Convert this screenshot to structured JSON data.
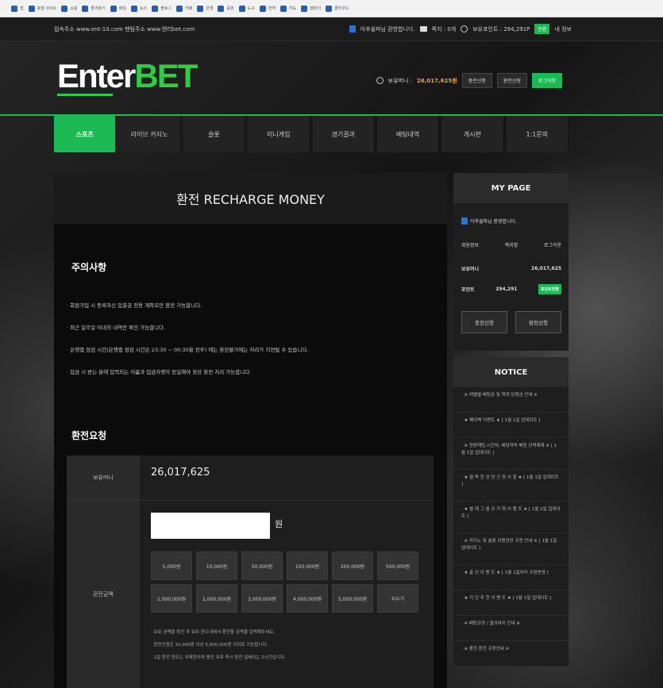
{
  "bookmarks": [
    "앱",
    "포털 사이트",
    "쇼핑",
    "즐겨찾기",
    "메일",
    "뉴스",
    "블로그",
    "카페",
    "은행",
    "증권",
    "도구",
    "번역",
    "지도",
    "캘린더",
    "클라우드"
  ],
  "topbar": {
    "site_address": "접속주소 www.ent-10.com 팬텀주소 www.엔터bet.com",
    "welcome": "아후쉴파님 환영합니다.",
    "messages": "쪽지 : 0개",
    "points_label": "보유포인트 : 294,291P",
    "points_btn": "전환",
    "my_info": "내 정보"
  },
  "header": {
    "logo_white": "Enter",
    "logo_green": "BET",
    "money_label": "보유머니 : ",
    "money_value": "26,017,625원",
    "btn_charge": "충전신청",
    "btn_exchange": "환전신청",
    "btn_logout": "로그아웃"
  },
  "nav": [
    "스포츠",
    "라이브 카지노",
    "슬롯",
    "미니게임",
    "경기결과",
    "배팅내역",
    "게시판",
    "1:1문의"
  ],
  "main": {
    "title": "환전 RECHARGE MONEY",
    "notice_title": "주의사항",
    "notices": [
      "회원가입 시 등록하신 입출금 전용 계좌로만 환전 가능합니다.",
      "최근 일주일 이내의 내역만 확인 가능합니다.",
      "은행별 점검 시간(은행별 점검 시간은 23:30 ~ 00:30을 전후) 에는 환전불가에는 처리가 지연될 수 있습니다.",
      "입금 시 받는 분에 입력되는 이름과 입금자명이 동일해야 정상 환전 처리 가능합니다."
    ],
    "request_title": "환전요청",
    "balance_label": "보유머니",
    "balance_value": "26,017,625",
    "amount_label": "환전금액",
    "amount_unit": "원",
    "amount_value": "",
    "quick_amounts": [
      "5,000원",
      "10,000원",
      "50,000원",
      "100,000원",
      "200,000원",
      "500,000원",
      "1,000,000원",
      "2,000,000원",
      "3,000,000원",
      "4,000,000원",
      "5,000,000원",
      "지우기"
    ],
    "hints": [
      "보유 금액을 확인 후 보유 한도내에서 환전할 금액을 입력해주세요.",
      "환전신청은 10,000원 이상 5,000,000원 이하로 가능합니다.",
      "1일 환전 한도는 무제한이며 충전 이후 즉시 환전 일배이는 2시간입니다."
    ]
  },
  "side": {
    "mypage_title": "MY PAGE",
    "welcome": "아후쉴파님 환영합니다.",
    "member_info": "회원정보",
    "messages": "쪽지함",
    "logout": "로그아웃",
    "money_label": "보유머니",
    "money_value": "26,017,625",
    "points_label": "포인트",
    "points_value": "294,291",
    "points_btn": "포인트전환",
    "btn_charge": "충전신청",
    "btn_exchange": "환전신청",
    "notice_title": "NOTICE",
    "notices": [
      "※ 레벨별 배팅금 및 최대 당첨금 안내 ※",
      "★ 페이백 이벤트 ★ [ 1월 1일 업데이트 ]",
      "※ 정방매팅,시간차, 배당하락 배팅 강력제재 ※ [ 1월 1일 업데이트 ]",
      "★ 월 독 한 앙 당 근 정 사 항 ★ [ 1월 1일 업데이트 ]",
      "★ 별 제 그 월 공 지 명 이 행 트 ★ [ 1월 2일 업데이트 ]",
      "※ 카지노 및 슬롯 이용관련 규정 안내 ※ [ 1월 1일 업데이트 ]",
      "★ 출 신 이 벤 트 ★ [ 1월 1일부터 규정변경 ]",
      "★ 지 인 추 천 이 벤 트 ★ [ 1월 1일 업데이트 ]",
      "※ 배팅규정 / 결과처리 안내 ※",
      "※ 충전 환전 규정안내 ※"
    ]
  },
  "colors": {
    "accent": "#1db954",
    "money": "#e8a824"
  }
}
